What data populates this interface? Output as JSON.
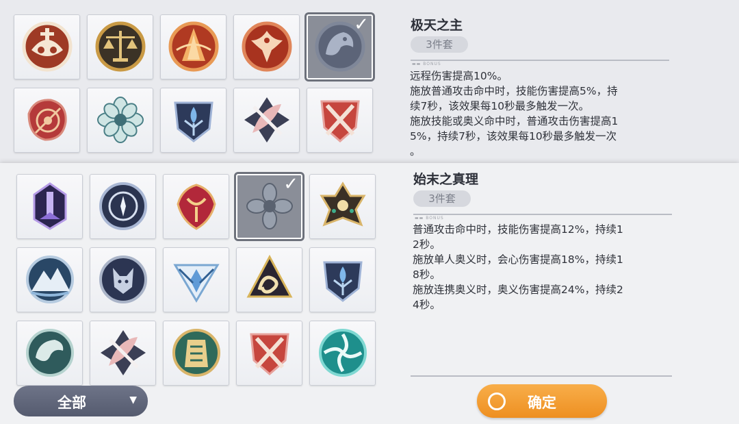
{
  "top_set": {
    "title": "极天之主",
    "badge": "3件套",
    "tiny_caption": "▬▬ BONUS",
    "description": "远程伤害提高10%。\n施放普通攻击命中时，技能伤害提高5%，持\n续7秒，该效果每10秒最多触发一次。\n施放技能或奥义命中时，普通攻击伤害提高1\n5%，持续7秒，该效果每10秒最多触发一次\n。",
    "selected_check": "✓"
  },
  "bottom_set": {
    "title": "始末之真理",
    "badge": "3件套",
    "tiny_caption": "▬▬ BONUS",
    "description": "普通攻击命中时，技能伤害提高12%，持续1\n2秒。\n施放单人奥义时，会心伤害提高18%，持续1\n8秒。\n施放连携奥义时，奥义伤害提高24%，持续2\n4秒。",
    "selected_check": "✓"
  },
  "filter": {
    "label": "全部",
    "arrow": "▼"
  },
  "confirm": {
    "label": "确定"
  },
  "icons": {
    "top_grid": [
      "owl-crest-icon",
      "scales-icon",
      "flame-pillar-icon",
      "phoenix-icon",
      "dragon-crest-icon",
      "crimson-target-icon",
      "teal-flower-icon",
      "blue-tree-icon",
      "crossed-feathers-icon",
      "red-blades-shield-icon"
    ],
    "bottom_grid": [
      "purple-tower-icon",
      "blue-compass-icon",
      "red-horn-shield-icon",
      "teal-flower-icon",
      "gold-lotus-icon",
      "mountain-icon",
      "fox-icon",
      "blue-crystal-icon",
      "serpent-triangle-icon",
      "blue-tree-icon",
      "dragon-head-icon",
      "crossed-feathers-icon",
      "pharaoh-icon",
      "red-blades-shield-icon",
      "teal-wind-icon"
    ]
  },
  "colors": {
    "accent_orange": "#f0962a",
    "selected_tile": "#8a8e98"
  }
}
